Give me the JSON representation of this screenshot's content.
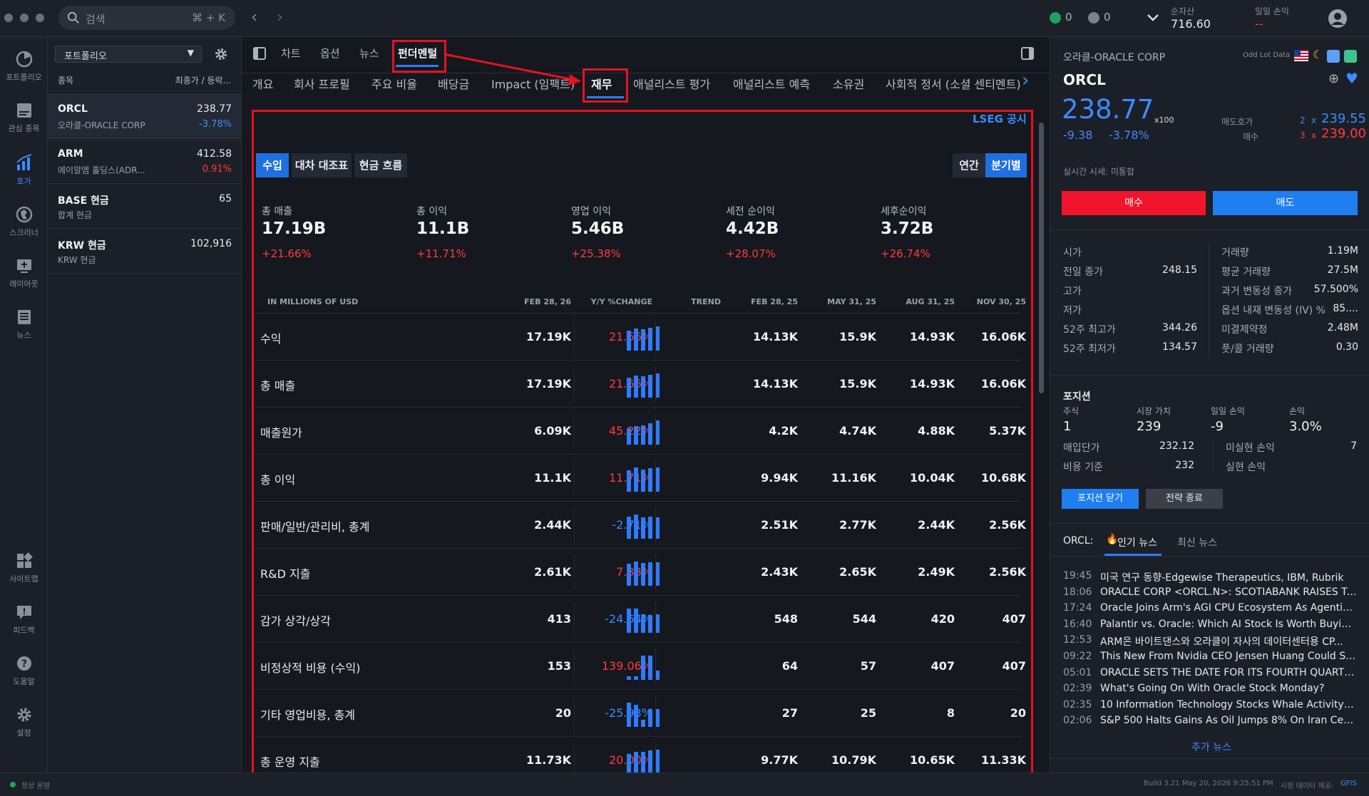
{
  "search": {
    "placeholder": "검색",
    "shortcut": "⌘ + K"
  },
  "status_icons": {
    "green_count": "0",
    "gray_count": "0"
  },
  "header_stats": {
    "net_assets_label": "순자산",
    "net_assets_value": "716.60",
    "daily_pl_label": "일일 손익",
    "daily_pl_value": "--"
  },
  "leftnav": [
    {
      "label": "포트폴리오",
      "icon": "portfolio-icon"
    },
    {
      "label": "관심 종목",
      "icon": "watchlist-icon"
    },
    {
      "label": "호가",
      "icon": "quote-icon"
    },
    {
      "label": "스크리너",
      "icon": "screener-icon"
    },
    {
      "label": "레이아웃",
      "icon": "layout-icon"
    },
    {
      "label": "뉴스",
      "icon": "news-icon"
    },
    {
      "label": "사이트맵",
      "icon": "sitemap-icon"
    },
    {
      "label": "피드백",
      "icon": "feedback-icon"
    },
    {
      "label": "도움말",
      "icon": "help-icon"
    },
    {
      "label": "설정",
      "icon": "settings-icon"
    }
  ],
  "portfolio": {
    "select_label": "포트폴리오",
    "head_left": "종목",
    "head_right": "최종가 / 등락...",
    "rows": [
      {
        "sym": "ORCL",
        "name": "오라클-ORACLE CORP",
        "price": "238.77",
        "chg": "-3.78%",
        "dir": "neg"
      },
      {
        "sym": "ARM",
        "name": "에이알엠 홀딩스(ADR...",
        "price": "412.58",
        "chg": "0.91%",
        "dir": "pos"
      },
      {
        "sym": "BASE 현금",
        "name": "합계 현금",
        "price": "65",
        "chg": "",
        "dir": ""
      },
      {
        "sym": "KRW 현금",
        "name": "KRW 현금",
        "price": "102,916",
        "chg": "",
        "dir": ""
      }
    ]
  },
  "main_tabs": [
    "차트",
    "옵션",
    "뉴스",
    "펀더멘털"
  ],
  "sub_tabs": [
    "개요",
    "회사 프로필",
    "주요 비율",
    "배당금",
    "Impact (임팩트)",
    "재무",
    "애널리스트 평가",
    "애널리스트 예측",
    "소유권",
    "사회적 정서 (소셜 센티멘트)"
  ],
  "lseg": "LSEG 공시",
  "statement_tabs": [
    "수입",
    "대차 대조표",
    "현금 흐름"
  ],
  "period_tabs": [
    "연간",
    "분기별"
  ],
  "kpis": [
    {
      "label": "총 매출",
      "value": "17.19B",
      "chg": "+21.66%"
    },
    {
      "label": "총 이익",
      "value": "11.1B",
      "chg": "+11.71%"
    },
    {
      "label": "영업 이익",
      "value": "5.46B",
      "chg": "+25.38%"
    },
    {
      "label": "세전 순이익",
      "value": "4.42B",
      "chg": "+28.07%"
    },
    {
      "label": "세후순이익",
      "value": "3.72B",
      "chg": "+26.74%"
    }
  ],
  "table": {
    "headers": [
      "IN MILLIONS OF USD",
      "FEB 28, 26",
      "Y/Y %CHANGE",
      "TREND",
      "FEB 28, 25",
      "MAY 31, 25",
      "AUG 31, 25",
      "NOV 30, 25"
    ],
    "rows": [
      {
        "label": "수익",
        "cur": "17.19K",
        "chg": "21.66%",
        "dir": "pos",
        "h1": "14.13K",
        "h2": "15.9K",
        "h3": "14.93K",
        "h4": "16.06K",
        "trend": [
          14.13,
          15.9,
          14.93,
          16.06,
          17.19
        ]
      },
      {
        "label": "총 매출",
        "cur": "17.19K",
        "chg": "21.66%",
        "dir": "pos",
        "h1": "14.13K",
        "h2": "15.9K",
        "h3": "14.93K",
        "h4": "16.06K",
        "trend": [
          14.13,
          15.9,
          14.93,
          16.06,
          17.19
        ]
      },
      {
        "label": "매출원가",
        "cur": "6.09K",
        "chg": "45.22%",
        "dir": "pos",
        "h1": "4.2K",
        "h2": "4.74K",
        "h3": "4.88K",
        "h4": "5.37K",
        "trend": [
          4.2,
          4.74,
          4.88,
          5.37,
          6.09
        ]
      },
      {
        "label": "총 이익",
        "cur": "11.1K",
        "chg": "11.71%",
        "dir": "pos",
        "h1": "9.94K",
        "h2": "11.16K",
        "h3": "10.04K",
        "h4": "10.68K",
        "trend": [
          9.94,
          11.16,
          10.04,
          10.68,
          11.1
        ]
      },
      {
        "label": "판매/일반/관리비, 총계",
        "cur": "2.44K",
        "chg": "-2.71%",
        "dir": "neg",
        "h1": "2.51K",
        "h2": "2.77K",
        "h3": "2.44K",
        "h4": "2.56K",
        "trend": [
          2.51,
          2.77,
          2.44,
          2.56,
          2.44
        ]
      },
      {
        "label": "R&D 지출",
        "cur": "2.61K",
        "chg": "7.33%",
        "dir": "pos",
        "h1": "2.43K",
        "h2": "2.65K",
        "h3": "2.49K",
        "h4": "2.56K",
        "trend": [
          2.43,
          2.65,
          2.49,
          2.56,
          2.61
        ]
      },
      {
        "label": "감가 상각/상각",
        "cur": "413",
        "chg": "-24.64%",
        "dir": "neg",
        "h1": "548",
        "h2": "544",
        "h3": "420",
        "h4": "407",
        "trend": [
          548,
          544,
          420,
          407,
          413
        ]
      },
      {
        "label": "비정상적 비용 (수익)",
        "cur": "153",
        "chg": "139.06%",
        "dir": "pos",
        "h1": "64",
        "h2": "57",
        "h3": "407",
        "h4": "407",
        "trend": [
          64,
          57,
          407,
          407,
          153
        ]
      },
      {
        "label": "기타 영업비용, 총계",
        "cur": "20",
        "chg": "-25.93%",
        "dir": "neg",
        "h1": "27",
        "h2": "25",
        "h3": "8",
        "h4": "20",
        "trend": [
          27,
          25,
          8,
          20,
          20
        ]
      },
      {
        "label": "총 운영 지출",
        "cur": "11.73K",
        "chg": "20.00%",
        "dir": "pos",
        "h1": "9.77K",
        "h2": "10.79K",
        "h3": "10.65K",
        "h4": "11.33K",
        "trend": [
          9.77,
          10.79,
          10.65,
          11.33,
          11.73
        ]
      }
    ]
  },
  "quote": {
    "company": "오라클-ORACLE CORP",
    "odd_lot": "Odd Lot Data",
    "symbol": "ORCL",
    "price": "238.77",
    "multiplier": "x100",
    "chg": "-9.38",
    "chg_pct": "-3.78%",
    "ask_label": "매도호가",
    "ask_size": "2",
    "ask_x": "x",
    "ask": "239.55",
    "bid_label": "매수",
    "bid_size": "3",
    "bid_x": "x",
    "bid": "239.00",
    "realtime": "실시간 시세: 미통합",
    "buy": "매수",
    "sell": "매도"
  },
  "stats_left": [
    {
      "label": "시가",
      "value": ""
    },
    {
      "label": "전일 종가",
      "value": "248.15"
    },
    {
      "label": "고가",
      "value": ""
    },
    {
      "label": "저가",
      "value": ""
    },
    {
      "label": "52주 최고가",
      "value": "344.26"
    },
    {
      "label": "52주 최저가",
      "value": "134.57"
    }
  ],
  "stats_right": [
    {
      "label": "거래량",
      "value": "1.19M"
    },
    {
      "label": "평균 거래량",
      "value": "27.5M"
    },
    {
      "label": "과거 변동성 종가",
      "value": "57.500%"
    },
    {
      "label": "옵션 내재 변동성 (IV) %",
      "value": "85...."
    },
    {
      "label": "미결제약정",
      "value": "2.48M"
    },
    {
      "label": "풋/콜 거래량",
      "value": "0.30"
    }
  ],
  "position": {
    "title": "포지션",
    "h_shares": "주식",
    "h_value": "시장 가치",
    "h_daily": "일일 손익",
    "h_pl": "손익",
    "shares": "1",
    "value": "239",
    "daily": "-9",
    "pl": "3.0%",
    "avg_label": "매입단가",
    "avg": "232.12",
    "unreal_label": "미실현 손익",
    "unreal": "7",
    "cost_label": "비용 기준",
    "cost": "232",
    "real_label": "실현 손익",
    "real": "",
    "close_btn": "포지션 닫기",
    "strategy_btn": "전략 종료"
  },
  "news": {
    "prefix": "ORCL:",
    "tab_hot": "인기 뉴스",
    "tab_latest": "최신 뉴스",
    "items": [
      {
        "time": "19:45",
        "title": "미국 연구 동향-Edgewise Therapeutics, IBM, Rubrik"
      },
      {
        "time": "18:06",
        "title": "ORACLE CORP <ORCL.N>: SCOTIABANK RAISES TARG..."
      },
      {
        "time": "17:24",
        "title": "Oracle Joins Arm's AGI CPU Ecosystem As Agentic AI ..."
      },
      {
        "time": "16:40",
        "title": "Palantir vs. Oracle: Which AI Stock Is Worth Buying in..."
      },
      {
        "time": "12:53",
        "title": "ARM은 바이트댄스와 오라클이 자사의 데이터센터용 CP..."
      },
      {
        "time": "09:22",
        "title": "This New From Nvidia CEO Jensen Huang Could Shi..."
      },
      {
        "time": "05:01",
        "title": "ORACLE SETS THE DATE FOR ITS FOURTH QUARTER ..."
      },
      {
        "time": "02:39",
        "title": "What's Going On With Oracle Stock Monday?"
      },
      {
        "time": "02:35",
        "title": "10 Information Technology Stocks Whale Activity In T..."
      },
      {
        "time": "02:06",
        "title": "S&P 500 Halts Gains As Oil Jumps 8% On Iran Ceasefi..."
      }
    ],
    "more": "추가 뉴스"
  },
  "statusbar": {
    "left": "정상 운영",
    "build": "Build 3.21 May 20, 2026 9:25:51 PM",
    "data": "시장 데이터 제공:",
    "provider": "GFIS"
  },
  "colors": {
    "accent": "#2f7bff",
    "up": "#ff3b3b",
    "down": "#3d8bff",
    "highlight": "#e8111f"
  }
}
